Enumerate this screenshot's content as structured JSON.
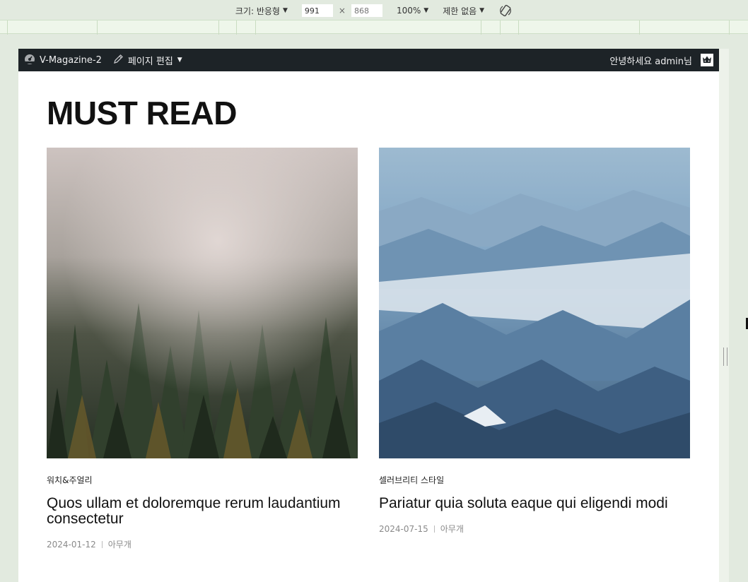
{
  "toolbar": {
    "size_label": "크기: 반응형",
    "width_value": "991",
    "height_value": "868",
    "times": "×",
    "zoom_label": "100%",
    "throttle_label": "제한 없음"
  },
  "adminbar": {
    "site_name": "V-Magazine-2",
    "edit_page": "페이지 편집",
    "greeting": "안녕하세요 admin님"
  },
  "section": {
    "title": "MUST READ"
  },
  "posts": [
    {
      "category": "워치&주얼리",
      "title": "Quos ullam et doloremque rerum laudantium consectetur",
      "date": "2024-01-12",
      "author": "아무개"
    },
    {
      "category": "셀러브리티 스타일",
      "title": "Pariatur quia soluta eaque qui eligendi modi",
      "date": "2024-07-15",
      "author": "아무개"
    }
  ],
  "colors": {
    "admin_bar": "#1d2327",
    "devtools_bg": "#e2eadf",
    "ruler": "#eef6ea"
  }
}
